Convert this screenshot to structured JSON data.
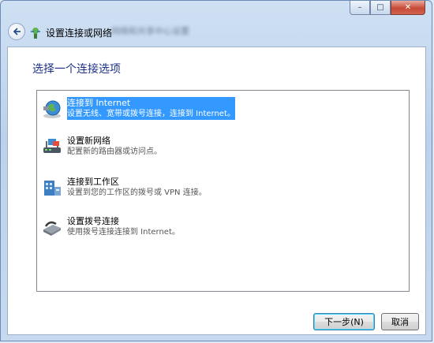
{
  "window": {
    "title": "设置连接或网络",
    "blurred_caption": "网络和共享中心设置",
    "caption_buttons": {
      "minimize": "–",
      "maximize": "□",
      "close": "✕"
    }
  },
  "nav": {
    "back_icon": "back-arrow-icon"
  },
  "heading": "选择一个连接选项",
  "options": [
    {
      "title": "连接到 Internet",
      "description": "设置无线、宽带或拨号连接，连接到 Internet。",
      "icon": "globe-icon",
      "selected": true
    },
    {
      "title": "设置新网络",
      "description": "配置新的路由器或访问点。",
      "icon": "router-icon",
      "selected": false
    },
    {
      "title": "连接到工作区",
      "description": "设置到您的工作区的拨号或 VPN 连接。",
      "icon": "workplace-icon",
      "selected": false
    },
    {
      "title": "设置拨号连接",
      "description": "使用拨号连接连接到 Internet。",
      "icon": "modem-icon",
      "selected": false
    }
  ],
  "buttons": {
    "next": "下一步(N)",
    "cancel": "取消"
  },
  "colors": {
    "selection": "#3399ff",
    "heading": "#1e3287"
  }
}
